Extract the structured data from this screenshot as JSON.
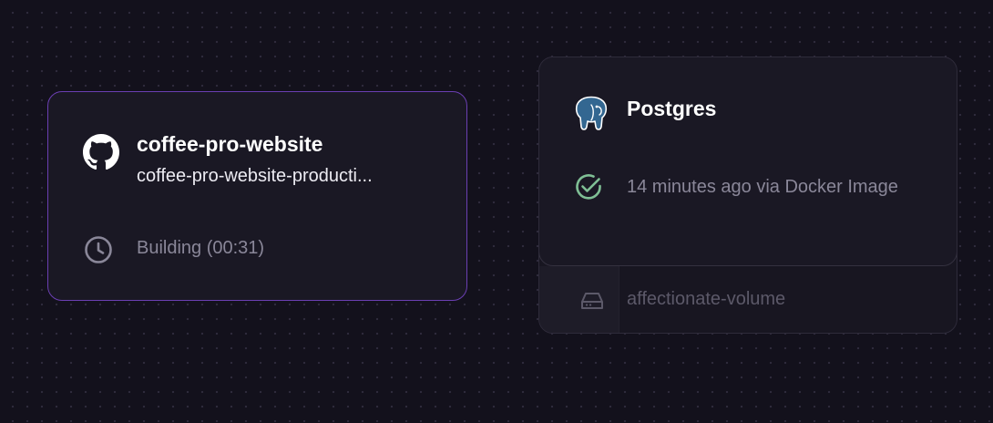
{
  "service": {
    "name": "coffee-pro-website",
    "domain": "coffee-pro-website-producti...",
    "status": "Building (00:31)",
    "icon": "github-icon",
    "status_icon": "clock-icon"
  },
  "database": {
    "name": "Postgres",
    "status": "14 minutes ago via Docker Image",
    "icon": "postgres-icon",
    "status_icon": "check-circle-icon",
    "volume": {
      "name": "affectionate-volume",
      "icon": "hard-drive-icon"
    }
  },
  "colors": {
    "canvas_bg": "#13111c",
    "card_bg": "#1a1824",
    "selected_border": "#6b3fb3",
    "success": "#7fbf95",
    "muted_text": "#8a8799"
  }
}
